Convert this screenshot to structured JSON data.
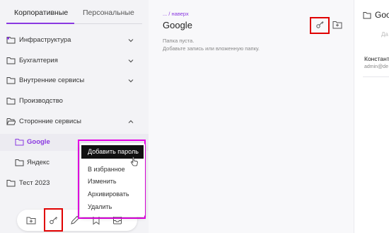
{
  "tabs": {
    "corporate": "Корпоративные",
    "personal": "Персональные"
  },
  "tree": [
    {
      "label": "Инфраструктура",
      "icon": "folder-shared-icon",
      "chevron": "down"
    },
    {
      "label": "Бухгалтерия",
      "icon": "folder-icon",
      "chevron": "down"
    },
    {
      "label": "Внутренние сервисы",
      "icon": "folder-icon",
      "chevron": "down"
    },
    {
      "label": "Производство",
      "icon": "folder-icon",
      "chevron": ""
    },
    {
      "label": "Сторонние сервисы",
      "icon": "folder-open-icon",
      "chevron": "up"
    },
    {
      "label": "Google",
      "icon": "folder-icon",
      "chevron": "",
      "selected": true
    },
    {
      "label": "Яндекс",
      "icon": "folder-icon",
      "chevron": ""
    },
    {
      "label": "Тест 2023",
      "icon": "folder-icon",
      "chevron": ""
    }
  ],
  "context_menu": {
    "primary": "Добавить пароль",
    "items": [
      "В избранное",
      "Изменить",
      "Архивировать",
      "Удалить"
    ]
  },
  "middle": {
    "breadcrumb": "... / наверх",
    "title": "Google",
    "empty_line1": "Папка пуста.",
    "empty_line2": "Добавьте запись или вложенную папку."
  },
  "right": {
    "title": "Goo",
    "tab": "Да",
    "user_name": "Констант",
    "user_email": "admin@de"
  },
  "colors": {
    "accent": "#8a39e1",
    "highlight": "#e00000",
    "menu_outline": "#e600e6"
  }
}
